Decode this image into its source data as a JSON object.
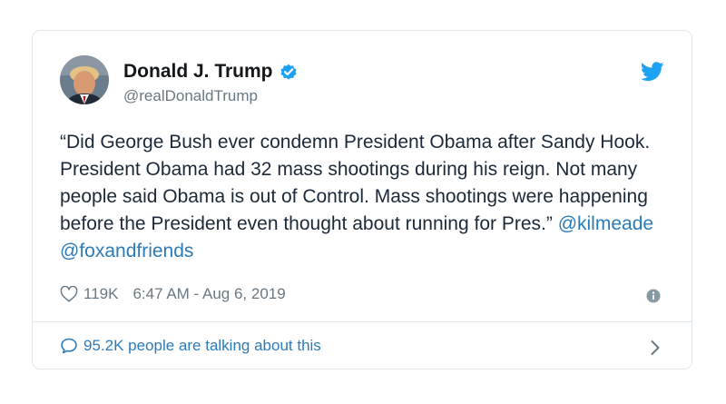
{
  "tweet": {
    "author_name": "Donald J. Trump",
    "handle": "@realDonaldTrump",
    "text": "“Did George Bush ever condemn President Obama after Sandy Hook. President Obama had 32 mass shootings during his reign. Not many people said Obama is out of Control. Mass shootings were happening before the President even thought about running for Pres.”",
    "mentions": [
      "@kilmeade",
      "@foxandfriends"
    ],
    "likes": "119K",
    "timestamp": "6:47 AM - Aug 6, 2019",
    "talking_about": "95.2K people are talking about this"
  },
  "icons": {
    "verified": "verified-badge-icon",
    "brand": "twitter-bird-icon",
    "like": "heart-icon",
    "info": "info-icon",
    "comment": "speech-bubble-icon",
    "more": "chevron-right-icon"
  },
  "colors": {
    "brand_blue": "#1da1f2",
    "link_blue": "#2b7bb9",
    "text": "#1c2938",
    "muted": "#697882",
    "border": "#e1e8ed"
  }
}
